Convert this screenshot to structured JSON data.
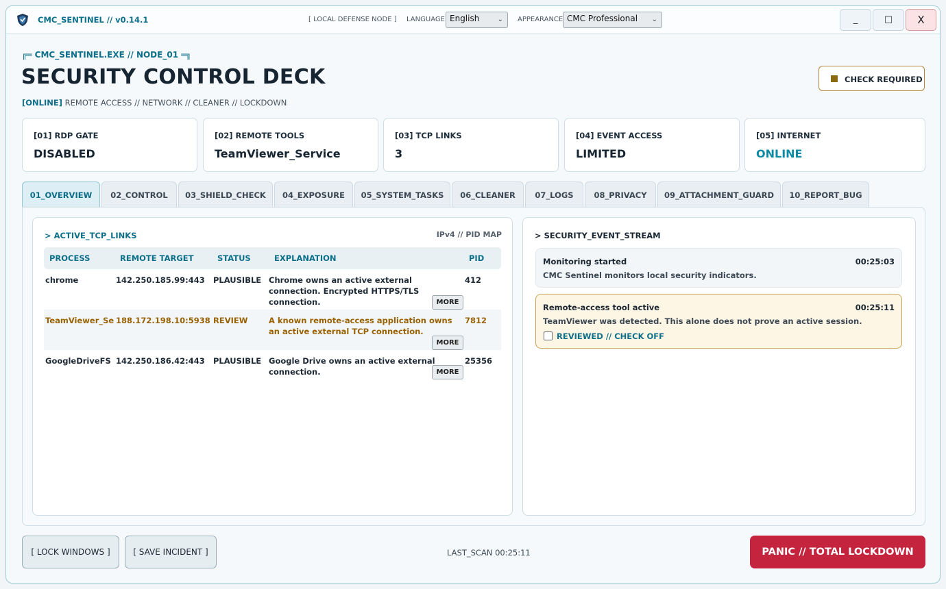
{
  "titlebar": {
    "app_title": "CMC_SENTINEL // v0.14.1",
    "node_label": "[ LOCAL DEFENSE NODE ]",
    "language_label": "LANGUAGE",
    "language_value": "English",
    "appearance_label": "APPEARANCE",
    "appearance_value": "CMC Professional",
    "minimize": "_",
    "maximize": "□",
    "close": "X"
  },
  "header": {
    "eyebrow_left": "╔═",
    "eyebrow": "CMC_SENTINEL.EXE // NODE_01",
    "eyebrow_right": "═╗",
    "title": "SECURITY CONTROL DECK",
    "status_tag": "[ONLINE]",
    "status_text": "REMOTE ACCESS // NETWORK // CLEANER // LOCKDOWN",
    "check_required": "CHECK REQUIRED"
  },
  "cards": [
    {
      "label": "[01] RDP GATE",
      "value": "DISABLED"
    },
    {
      "label": "[02] REMOTE TOOLS",
      "value": "TeamViewer_Service"
    },
    {
      "label": "[03] TCP LINKS",
      "value": "3"
    },
    {
      "label": "[04] EVENT ACCESS",
      "value": "LIMITED"
    },
    {
      "label": "[05] INTERNET",
      "value": "ONLINE"
    }
  ],
  "tabs": [
    {
      "label": "01_OVERVIEW"
    },
    {
      "label": "02_CONTROL"
    },
    {
      "label": "03_SHIELD_CHECK"
    },
    {
      "label": "04_EXPOSURE"
    },
    {
      "label": "05_SYSTEM_TASKS"
    },
    {
      "label": "06_CLEANER"
    },
    {
      "label": "07_LOGS"
    },
    {
      "label": "08_PRIVACY"
    },
    {
      "label": "09_ATTACHMENT_GUARD"
    },
    {
      "label": "10_REPORT_BUG"
    }
  ],
  "tcp": {
    "title": "> ACTIVE_TCP_LINKS",
    "meta": "IPv4 // PID MAP",
    "columns": {
      "process": "PROCESS",
      "remote": "REMOTE TARGET",
      "status": "STATUS",
      "explanation": "EXPLANATION",
      "pid": "PID"
    },
    "more_label": "MORE",
    "rows": [
      {
        "process": "chrome",
        "remote": "142.250.185.99:443",
        "status": "PLAUSIBLE",
        "explanation": "Chrome owns an active external connection. Encrypted HTTPS/TLS connection.",
        "pid": "412"
      },
      {
        "process": "TeamViewer_Service",
        "remote": "188.172.198.10:5938",
        "status": "REVIEW",
        "explanation": "A known remote-access application owns an active external TCP connection.",
        "pid": "7812"
      },
      {
        "process": "GoogleDriveFS",
        "remote": "142.250.186.42:443",
        "status": "PLAUSIBLE",
        "explanation": "Google Drive owns an active external connection.",
        "pid": "25356"
      }
    ]
  },
  "events": {
    "title": "> SECURITY_EVENT_STREAM",
    "items": [
      {
        "title": "Monitoring started",
        "time": "00:25:03",
        "text": "CMC Sentinel monitors local security indicators."
      },
      {
        "title": "Remote-access tool active",
        "time": "00:25:11",
        "text": "TeamViewer was detected. This alone does not prove an active session.",
        "check_label": "REVIEWED // CHECK OFF"
      }
    ]
  },
  "footer": {
    "lock_windows": "[ LOCK WINDOWS ]",
    "save_incident": "[ SAVE INCIDENT ]",
    "last_scan": "LAST_SCAN 00:25:11",
    "panic": "PANIC // TOTAL LOCKDOWN"
  },
  "colors": {
    "accent": "#0d6f8a",
    "warning": "#9a6200",
    "danger": "#c5243f"
  }
}
